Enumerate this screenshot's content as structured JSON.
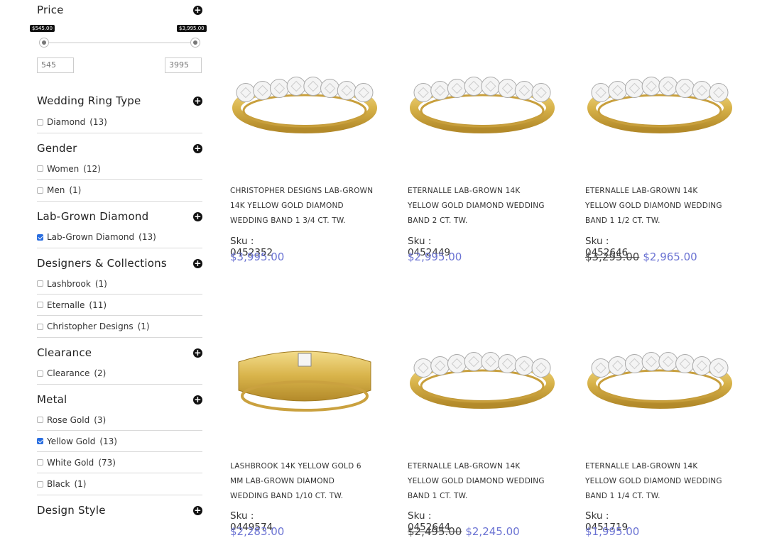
{
  "filters": {
    "price": {
      "title": "Price",
      "min_tag": "$545.00",
      "max_tag": "$3,995.00",
      "min_value": "545",
      "max_value": "3995"
    },
    "wedding_ring_type": {
      "title": "Wedding Ring Type",
      "options": [
        {
          "label": "Diamond",
          "count": "(13)",
          "checked": false
        }
      ]
    },
    "gender": {
      "title": "Gender",
      "options": [
        {
          "label": "Women",
          "count": "(12)",
          "checked": false
        },
        {
          "label": "Men",
          "count": "(1)",
          "checked": false
        }
      ]
    },
    "lab_grown": {
      "title": "Lab-Grown Diamond",
      "options": [
        {
          "label": "Lab-Grown Diamond",
          "count": "(13)",
          "checked": true
        }
      ]
    },
    "designers": {
      "title": "Designers & Collections",
      "options": [
        {
          "label": "Lashbrook",
          "count": "(1)",
          "checked": false
        },
        {
          "label": "Eternalle",
          "count": "(11)",
          "checked": false
        },
        {
          "label": "Christopher Designs",
          "count": "(1)",
          "checked": false
        }
      ]
    },
    "clearance": {
      "title": "Clearance",
      "options": [
        {
          "label": "Clearance",
          "count": "(2)",
          "checked": false
        }
      ]
    },
    "metal": {
      "title": "Metal",
      "options": [
        {
          "label": "Rose Gold",
          "count": "(3)",
          "checked": false
        },
        {
          "label": "Yellow Gold",
          "count": "(13)",
          "checked": true
        },
        {
          "label": "White Gold",
          "count": "(73)",
          "checked": false
        },
        {
          "label": "Black",
          "count": "(1)",
          "checked": false
        }
      ]
    },
    "design_style": {
      "title": "Design Style"
    }
  },
  "products": [
    {
      "name_lines": [
        "CHRISTOPHER DESIGNS LAB-GROWN",
        "14K YELLOW GOLD DIAMOND",
        "WEDDING BAND 1 3/4 CT. TW."
      ],
      "sku": "Sku : 0452352",
      "old_price": "",
      "price": "$3,995.00",
      "style": "eternity-logo"
    },
    {
      "name_lines": [
        "ETERNALLE LAB-GROWN 14K",
        "YELLOW GOLD DIAMOND WEDDING",
        "BAND 2 CT. TW."
      ],
      "sku": "Sku : 0452449",
      "old_price": "",
      "price": "$2,995.00",
      "style": "eternity"
    },
    {
      "name_lines": [
        "ETERNALLE LAB-GROWN 14K",
        "YELLOW GOLD DIAMOND WEDDING",
        "BAND 1 1/2 CT. TW."
      ],
      "sku": "Sku : 0452646",
      "old_price": "$3,295.00",
      "price": "$2,965.00",
      "style": "eternity"
    },
    {
      "name_lines": [
        "LASHBROOK 14K YELLOW GOLD 6",
        "MM LAB-GROWN DIAMOND",
        "WEDDING BAND 1/10 CT. TW."
      ],
      "sku": "Sku : 0449574",
      "old_price": "",
      "price": "$2,283.00",
      "style": "solitaire"
    },
    {
      "name_lines": [
        "ETERNALLE LAB-GROWN 14K",
        "YELLOW GOLD DIAMOND WEDDING",
        "BAND 1 CT. TW."
      ],
      "sku": "Sku : 0452644",
      "old_price": "$2,495.00",
      "price": "$2,245.00",
      "style": "eternity"
    },
    {
      "name_lines": [
        "ETERNALLE LAB-GROWN 14K",
        "YELLOW GOLD DIAMOND WEDDING",
        "BAND 1 1/4 CT. TW."
      ],
      "sku": "Sku : 0451719",
      "old_price": "",
      "price": "$1,995.00",
      "style": "eternity"
    }
  ],
  "colors": {
    "accent_price": "#6b73d3",
    "gold": "#d8b34a",
    "check": "#2a6ee0"
  }
}
